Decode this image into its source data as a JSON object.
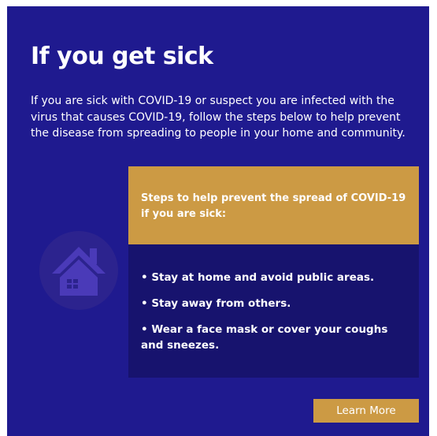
{
  "header": {
    "title": "If you get sick"
  },
  "intro": {
    "text": "If you are sick with COVID-19 or suspect you are infected with the virus that causes COVID-19, follow the steps below to help prevent the disease from spreading to people in your home and community."
  },
  "card": {
    "heading": "Steps to help prevent the spread of COVID-19 if you are sick:",
    "steps": [
      "• Stay at home and avoid public areas.",
      "• Stay away from others.",
      "• Wear a face mask or cover your coughs and sneezes."
    ]
  },
  "actions": {
    "learn_more_label": "Learn More"
  },
  "icons": {
    "home": "house-icon"
  },
  "colors": {
    "background": "#1f1a8f",
    "accent": "#cc9a44",
    "card_body": "#17136e",
    "icon_circle": "#2c238e",
    "icon_fill": "#4a3ab8"
  }
}
